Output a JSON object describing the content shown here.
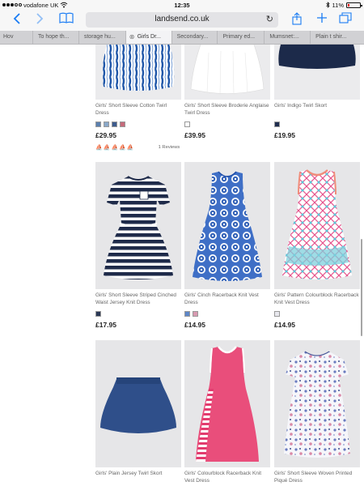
{
  "status_bar": {
    "carrier": "vodafone UK",
    "time": "12:35",
    "battery": "11%"
  },
  "toolbar": {
    "url": "landsend.co.uk"
  },
  "tabs": [
    {
      "label": "Hov",
      "active": false
    },
    {
      "label": "To hope th...",
      "active": false
    },
    {
      "label": "storage hu...",
      "active": false
    },
    {
      "label": "Girls Dr...",
      "active": true
    },
    {
      "label": "Secondary...",
      "active": false
    },
    {
      "label": "Primary ed...",
      "active": false
    },
    {
      "label": "Mumsnet:...",
      "active": false
    },
    {
      "label": "Plain t shir...",
      "active": false
    }
  ],
  "products": [
    {
      "name": "Girls' Short Sleeve Cotton Twirl Dress",
      "price": "£29.95",
      "swatches": [
        "#5b7fae",
        "#8aa8c8",
        "#3c5b8c",
        "#c56a7a"
      ],
      "rating_text": "1 Reviews"
    },
    {
      "name": "Girls' Short Sleeve Broderie Anglaise Twirl Dress",
      "price": "£39.95",
      "swatches": [
        "#ffffff"
      ]
    },
    {
      "name": "Girls' Indigo Twirl Skort",
      "price": "£19.95",
      "swatches": [
        "#1f2d4f"
      ]
    },
    {
      "name": "Girls' Short Sleeve Striped Cinched Waist Jersey Knit Dress",
      "price": "£17.95",
      "swatches": [
        "#2a3856"
      ]
    },
    {
      "name": "Girls' Cinch Racerback Knit Vest Dress",
      "price": "£14.95",
      "swatches": [
        "#5d86c7",
        "#d89ab0"
      ]
    },
    {
      "name": "Girls' Pattern Colourblock Racerback Knit Vest Dress",
      "price": "£14.95",
      "swatches": [
        "#e8e8ee"
      ]
    },
    {
      "name": "Girls' Plain Jersey Twirl Skort",
      "price": "",
      "swatches": []
    },
    {
      "name": "Girls' Colourblock Racerback Knit Vest Dress",
      "price": "",
      "swatches": []
    },
    {
      "name": "Girls' Short Sleeve Woven Printed Piqué Dress",
      "price": "",
      "swatches": []
    }
  ]
}
